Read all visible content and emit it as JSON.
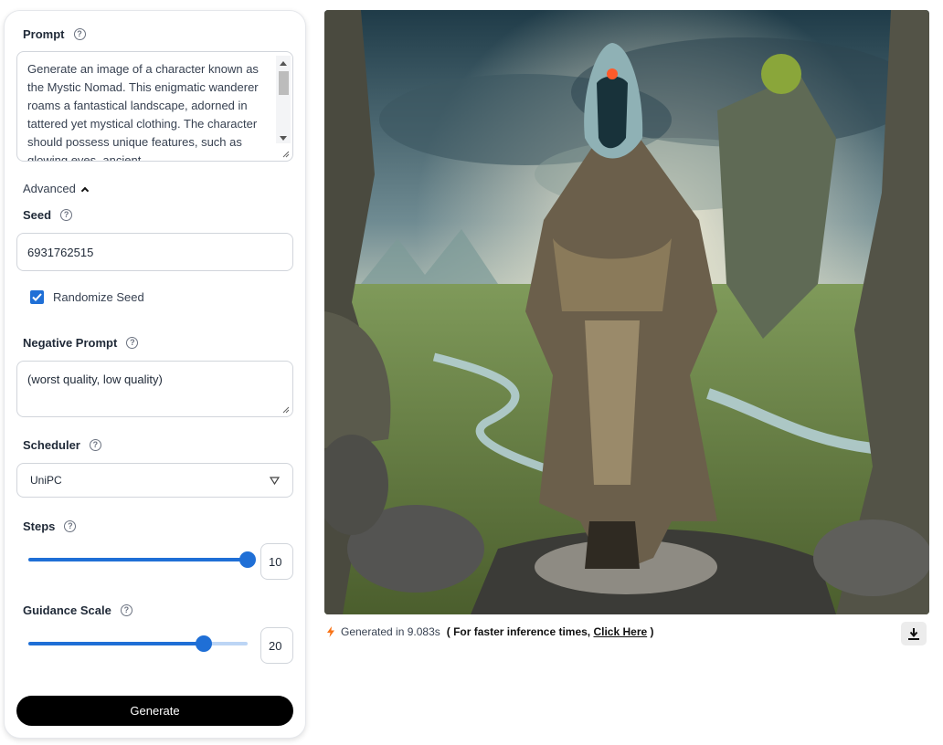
{
  "prompt": {
    "label": "Prompt",
    "value": "Generate an image of a character known as the Mystic Nomad. This enigmatic wanderer roams a fantastical landscape, adorned in tattered yet mystical clothing. The character should possess unique features, such as glowing eyes, ancient"
  },
  "advanced": {
    "label": "Advanced"
  },
  "seed": {
    "label": "Seed",
    "value": "6931762515"
  },
  "randomize": {
    "label": "Randomize Seed",
    "checked": true
  },
  "negative": {
    "label": "Negative Prompt",
    "value": "(worst quality, low quality)"
  },
  "scheduler": {
    "label": "Scheduler",
    "value": "UniPC"
  },
  "steps": {
    "label": "Steps",
    "value": "10",
    "fraction": 1.0
  },
  "guidance": {
    "label": "Guidance Scale",
    "value": "20",
    "fraction": 0.8
  },
  "generate_label": "Generate",
  "status": {
    "prefix": "Generated in 9.083s",
    "bold_open": "( For faster inference times, ",
    "link": "Click Here",
    "bold_close": " )"
  },
  "colors": {
    "accent": "#1f6fd6",
    "status_icon": "#f97316"
  },
  "icons": [
    "help-icon",
    "chevron-up-icon",
    "check-icon",
    "dropdown-caret-icon",
    "lightning-icon",
    "download-icon"
  ]
}
